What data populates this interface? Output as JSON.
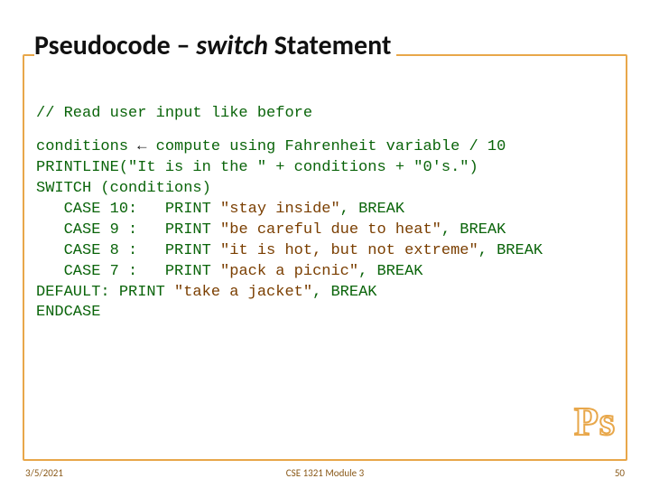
{
  "title": {
    "pre": "Pseudocode – ",
    "italic": "switch",
    "post": " Statement"
  },
  "code": {
    "comment": "// Read user input like before",
    "assign_pre": "conditions ",
    "assign_arrow": "←",
    "assign_post": " compute using Fahrenheit variable / 10",
    "printline": "PRINTLINE(\"It is in the \" + conditions + \"0's.\")",
    "switch": "SWITCH (conditions)",
    "c10a": "   CASE 10:   PRINT ",
    "c10b": "\"stay inside\"",
    "c10c": ", BREAK",
    "c9a": "   CASE 9 :   PRINT ",
    "c9b": "\"be careful due to heat\"",
    "c9c": ", BREAK",
    "c8a": "   CASE 8 :   PRINT ",
    "c8b": "\"it is hot, but not extreme\"",
    "c8c": ", BREAK",
    "c7a": "   CASE 7 :   PRINT ",
    "c7b": "\"pack a picnic\"",
    "c7c": ", BREAK",
    "defa": "DEFAULT: PRINT ",
    "defb": "\"take a jacket\"",
    "defc": ", BREAK",
    "endcase": "ENDCASE"
  },
  "badge": "Ps",
  "footer": {
    "date": "3/5/2021",
    "center": "CSE 1321 Module 3",
    "page": "50"
  }
}
